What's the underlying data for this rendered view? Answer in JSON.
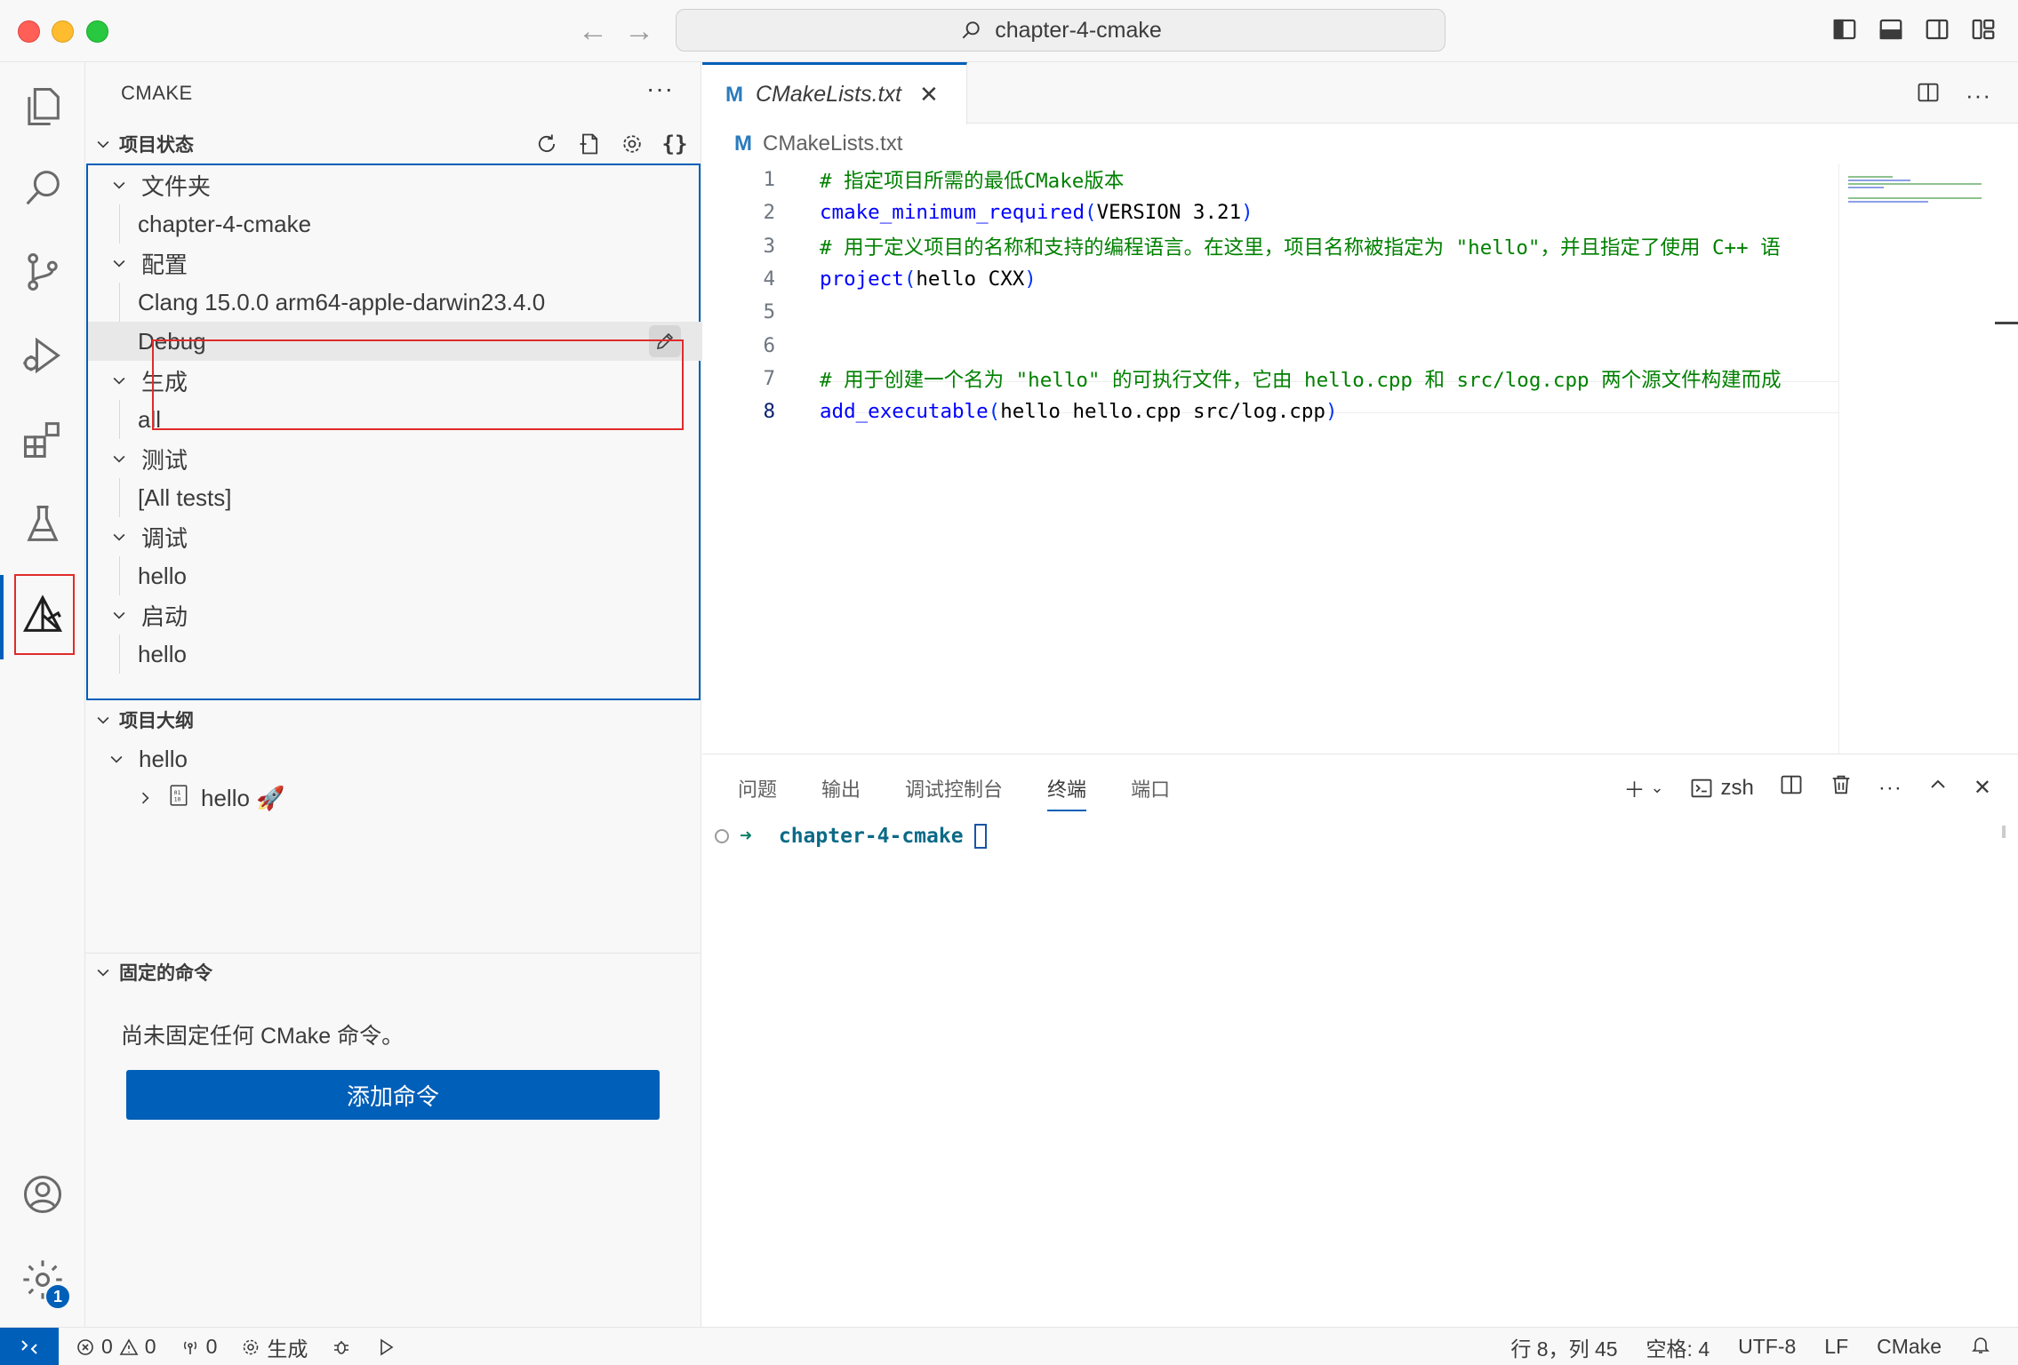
{
  "window": {
    "search_text": "chapter-4-cmake"
  },
  "sidebar": {
    "title": "CMAKE",
    "more": "···",
    "project_status": {
      "header": "项目状态",
      "folder_label": "文件夹",
      "folder_value": "chapter-4-cmake",
      "config_label": "配置",
      "kit_value": "Clang 15.0.0 arm64-apple-darwin23.4.0",
      "variant_value": "Debug",
      "build_label": "生成",
      "build_value": "all",
      "test_label": "测试",
      "test_value": "[All tests]",
      "debug_label": "调试",
      "debug_value": "hello",
      "launch_label": "启动",
      "launch_value": "hello"
    },
    "outline": {
      "header": "项目大纲",
      "project": "hello",
      "target": "hello 🚀"
    },
    "pinned": {
      "header": "固定的命令",
      "empty_text": "尚未固定任何 CMake 命令。",
      "add_button": "添加命令"
    }
  },
  "editor": {
    "tab_label": "CMakeLists.txt",
    "tab_icon": "M",
    "breadcrumb": "CMakeLists.txt",
    "lines": [
      {
        "n": "1",
        "parts": [
          [
            "c-com",
            "# 指定项目所需的最低CMake版本"
          ]
        ]
      },
      {
        "n": "2",
        "parts": [
          [
            "c-fn",
            "cmake_minimum_required"
          ],
          [
            "c-paren",
            "("
          ],
          [
            "c-txt",
            "VERSION 3.21"
          ],
          [
            "c-paren",
            ")"
          ]
        ]
      },
      {
        "n": "3",
        "parts": [
          [
            "c-com",
            "# 用于定义项目的名称和支持的编程语言。在这里，项目名称被指定为 \"hello\"，并且指定了使用 C++ 语"
          ]
        ]
      },
      {
        "n": "4",
        "parts": [
          [
            "c-fn",
            "project"
          ],
          [
            "c-paren",
            "("
          ],
          [
            "c-txt",
            "hello CXX"
          ],
          [
            "c-paren",
            ")"
          ]
        ]
      },
      {
        "n": "5",
        "parts": []
      },
      {
        "n": "6",
        "parts": []
      },
      {
        "n": "7",
        "parts": [
          [
            "c-com",
            "# 用于创建一个名为 \"hello\" 的可执行文件，它由 hello.cpp 和 src/log.cpp 两个源文件构建而成"
          ]
        ]
      },
      {
        "n": "8",
        "parts": [
          [
            "c-fn",
            "add_executable"
          ],
          [
            "c-paren",
            "("
          ],
          [
            "c-txt",
            "hello hello.cpp src/log.cpp"
          ],
          [
            "c-paren",
            ")"
          ]
        ]
      }
    ]
  },
  "panel": {
    "tabs": [
      "问题",
      "输出",
      "调试控制台",
      "终端",
      "端口"
    ],
    "active_tab": "终端",
    "shell_label": "zsh",
    "prompt_dir": "chapter-4-cmake"
  },
  "statusbar": {
    "errors": "0",
    "warnings": "0",
    "ports": "0",
    "build_label": "生成",
    "position": "行 8，列 45",
    "spaces": "空格: 4",
    "encoding": "UTF-8",
    "eol": "LF",
    "language": "CMake"
  },
  "activity": {
    "settings_badge": "1"
  },
  "colors": {
    "accent": "#005fb8",
    "highlight_box": "#e02b2b"
  }
}
